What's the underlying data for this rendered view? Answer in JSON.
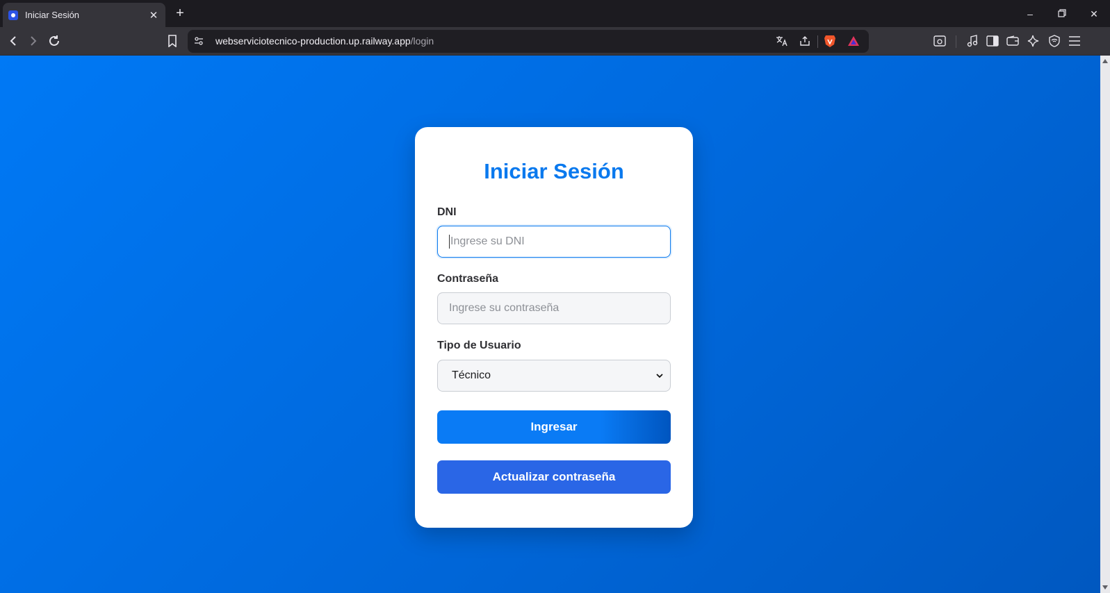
{
  "browser": {
    "tab_title": "Iniciar Sesión",
    "url_host": "webserviciotecnico-production.up.railway.app",
    "url_path": "/login"
  },
  "login": {
    "title": "Iniciar Sesión",
    "dni_label": "DNI",
    "dni_placeholder": "Ingrese su DNI",
    "password_label": "Contraseña",
    "password_placeholder": "Ingrese su contraseña",
    "user_type_label": "Tipo de Usuario",
    "user_type_selected": "Técnico",
    "submit_label": "Ingresar",
    "update_password_label": "Actualizar contraseña"
  },
  "colors": {
    "page_gradient_start": "#0079f5",
    "page_gradient_end": "#0058c0",
    "title": "#0a79ee",
    "primary_button": "#0a7bf5",
    "secondary_button": "#2a66e6"
  }
}
